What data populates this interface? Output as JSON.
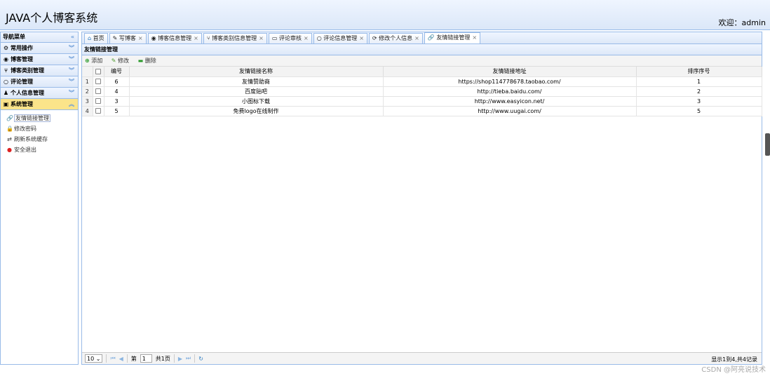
{
  "header": {
    "title": "JAVA个人博客系统",
    "welcome": "欢迎：admin"
  },
  "sidebar": {
    "title": "导航菜单",
    "sections": [
      {
        "label": "常用操作",
        "icon": "gear-icon"
      },
      {
        "label": "博客管理",
        "icon": "blog-icon"
      },
      {
        "label": "博客类别管理",
        "icon": "tree-icon"
      },
      {
        "label": "评论管理",
        "icon": "comment-icon"
      },
      {
        "label": "个人信息管理",
        "icon": "user-icon"
      },
      {
        "label": "系统管理",
        "icon": "system-icon"
      }
    ],
    "sub_items": [
      {
        "label": "友情链接管理"
      },
      {
        "label": "修改密码"
      },
      {
        "label": "刷新系统缓存"
      },
      {
        "label": "安全退出"
      }
    ]
  },
  "tabs": [
    {
      "label": "首页",
      "icon": "⌂"
    },
    {
      "label": "写博客",
      "icon": "✎"
    },
    {
      "label": "博客信息管理",
      "icon": "◉"
    },
    {
      "label": "博客类别信息管理",
      "icon": "⑂"
    },
    {
      "label": "评论审核",
      "icon": "▭"
    },
    {
      "label": "评论信息管理",
      "icon": "○"
    },
    {
      "label": "修改个人信息",
      "icon": "⟳"
    },
    {
      "label": "友情链接管理",
      "icon": "🔗"
    }
  ],
  "panel": {
    "title": "友情链接管理"
  },
  "toolbar": {
    "add": "添加",
    "edit": "修改",
    "delete": "删除"
  },
  "table": {
    "headers": [
      "编号",
      "友情链接名称",
      "友情链接地址",
      "排序序号"
    ],
    "rows": [
      {
        "rn": "1",
        "id": "6",
        "name": "友情赞助商",
        "url": "https://shop114778678.taobao.com/",
        "order": "1"
      },
      {
        "rn": "2",
        "id": "4",
        "name": "百度贴吧",
        "url": "http://tieba.baidu.com/",
        "order": "2"
      },
      {
        "rn": "3",
        "id": "3",
        "name": "小图标下载",
        "url": "http://www.easyicon.net/",
        "order": "3"
      },
      {
        "rn": "4",
        "id": "5",
        "name": "免费logo在线制作",
        "url": "http://www.uugai.com/",
        "order": "5"
      }
    ]
  },
  "pager": {
    "page_size": "10",
    "page_prefix": "第",
    "page": "1",
    "total_pages": "共1页",
    "info": "显示1到4,共4记录"
  },
  "watermark": "CSDN @阿亮说技术"
}
